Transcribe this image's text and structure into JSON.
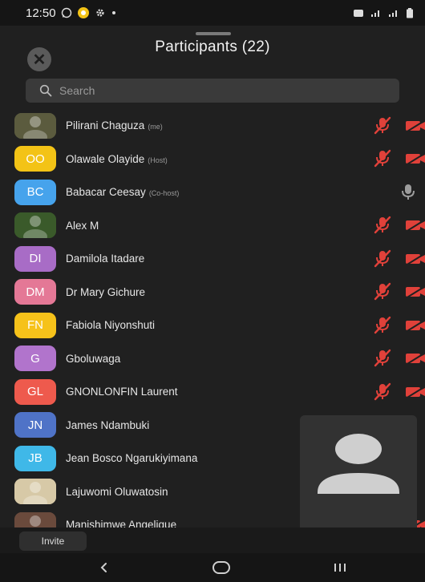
{
  "status_bar": {
    "time": "12:50",
    "left_icons": [
      "whatsapp-icon",
      "chat-bubble-icon",
      "settings-icon",
      "dot-icon"
    ],
    "right_icons": [
      "alarm-icon",
      "signal-icon",
      "signal-icon",
      "battery-icon"
    ]
  },
  "header": {
    "title": "Participants (22)"
  },
  "search": {
    "placeholder": "Search"
  },
  "participants": [
    {
      "name": "Pilirani Chaguza",
      "role": "(me)",
      "initials": "",
      "color": "#5b5b3e",
      "photo": "photo-1",
      "mic": "muted",
      "cam": "off"
    },
    {
      "name": "Olawale Olayide",
      "role": "(Host)",
      "initials": "OO",
      "color": "#f3c316",
      "mic": "muted",
      "cam": "off"
    },
    {
      "name": "Babacar Ceesay",
      "role": "(Co-host)",
      "initials": "BC",
      "color": "#46a3ec",
      "mic": "on",
      "cam": ""
    },
    {
      "name": "Alex M",
      "role": "",
      "initials": "",
      "color": "#3a5a2a",
      "photo": "photo-2",
      "mic": "muted",
      "cam": "off"
    },
    {
      "name": "Damilola Itadare",
      "role": "",
      "initials": "DI",
      "color": "#a86cc6",
      "mic": "muted",
      "cam": "off"
    },
    {
      "name": "Dr Mary Gichure",
      "role": "",
      "initials": "DM",
      "color": "#e47896",
      "mic": "muted",
      "cam": "off"
    },
    {
      "name": "Fabiola Niyonshuti",
      "role": "",
      "initials": "FN",
      "color": "#f6c21a",
      "mic": "muted",
      "cam": "off"
    },
    {
      "name": "Gboluwaga",
      "role": "",
      "initials": "G",
      "color": "#b174cc",
      "mic": "muted",
      "cam": "off"
    },
    {
      "name": "GNONLONFIN Laurent",
      "role": "",
      "initials": "GL",
      "color": "#ee5a4d",
      "mic": "muted",
      "cam": "off"
    },
    {
      "name": "James Ndambuki",
      "role": "",
      "initials": "JN",
      "color": "#4f73c7",
      "mic": "",
      "cam": ""
    },
    {
      "name": "Jean Bosco Ngarukiyimana",
      "role": "",
      "initials": "JB",
      "color": "#3fb8e8",
      "mic": "",
      "cam": ""
    },
    {
      "name": "Lajuwomi Oluwatosin",
      "role": "",
      "initials": "",
      "color": "#d7c9a7",
      "photo": "photo-3",
      "mic": "",
      "cam": ""
    },
    {
      "name": "Manishimwe Angelique",
      "role": "",
      "initials": "",
      "color": "#6a4a3c",
      "photo": "photo-4",
      "mic": "muted",
      "cam": "off"
    }
  ],
  "bottom_bar": {
    "invite_label": "Invite"
  },
  "nav": {
    "back_icon": "back-icon",
    "home_icon": "home-icon",
    "recents_icon": "recents-icon"
  },
  "colors": {
    "muted_red": "#e0413a",
    "background": "#202020"
  }
}
